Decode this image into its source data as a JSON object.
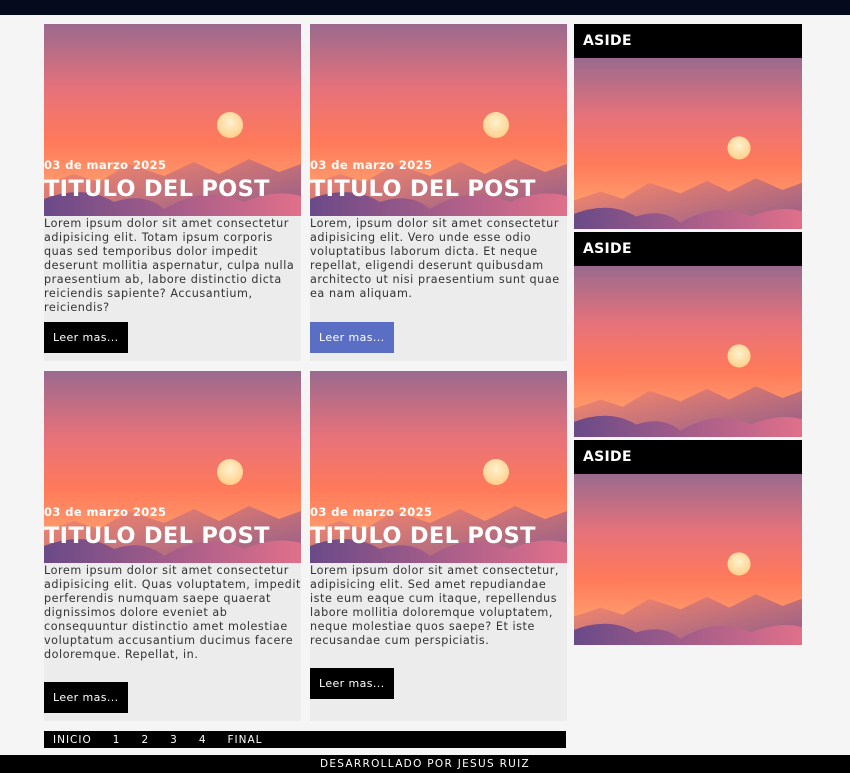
{
  "posts": [
    {
      "date": "03 de marzo 2025",
      "title": "TITULO DEL POST",
      "excerpt": "Lorem ipsum dolor sit amet consectetur adipisicing elit. Totam ipsum corporis quas sed temporibus dolor impedit deserunt mollitia aspernatur, culpa nulla praesentium ab, labore distinctio dicta reiciendis sapiente? Accusantium, reiciendis?",
      "button": "Leer mas..."
    },
    {
      "date": "03 de marzo 2025",
      "title": "TITULO DEL POST",
      "excerpt": "Lorem, ipsum dolor sit amet consectetur adipisicing elit. Vero unde esse odio voluptatibus laborum dicta. Et neque repellat, eligendi deserunt quibusdam architecto ut nisi praesentium sunt quae ea nam aliquam.",
      "button": "Leer mas..."
    },
    {
      "date": "03 de marzo 2025",
      "title": "TITULO DEL POST",
      "excerpt": "Lorem ipsum dolor sit amet consectetur adipisicing elit. Quas voluptatem, impedit perferendis numquam saepe quaerat dignissimos dolore eveniet ab consequuntur distinctio amet molestiae voluptatum accusantium ducimus facere doloremque. Repellat, in.",
      "button": "Leer mas..."
    },
    {
      "date": "03 de marzo 2025",
      "title": "TITULO DEL POST",
      "excerpt": "Lorem ipsum dolor sit amet consectetur, adipisicing elit. Sed amet repudiandae iste eum eaque cum itaque, repellendus labore mollitia doloremque voluptatem, neque molestiae quos saepe? Et iste recusandae cum perspiciatis.",
      "button": "Leer mas..."
    }
  ],
  "aside": [
    {
      "title": "ASIDE"
    },
    {
      "title": "ASIDE"
    },
    {
      "title": "ASIDE"
    }
  ],
  "pagination": {
    "first": "INICIO",
    "pages": [
      "1",
      "2",
      "3",
      "4"
    ],
    "last": "FINAL"
  },
  "footer": {
    "text": "DESARROLLADO POR JESUS RUIZ"
  },
  "colors": {
    "topbar": "#050a1c",
    "button": "#000000",
    "button_active": "#5a6fc4",
    "card_bg": "#ececec"
  }
}
